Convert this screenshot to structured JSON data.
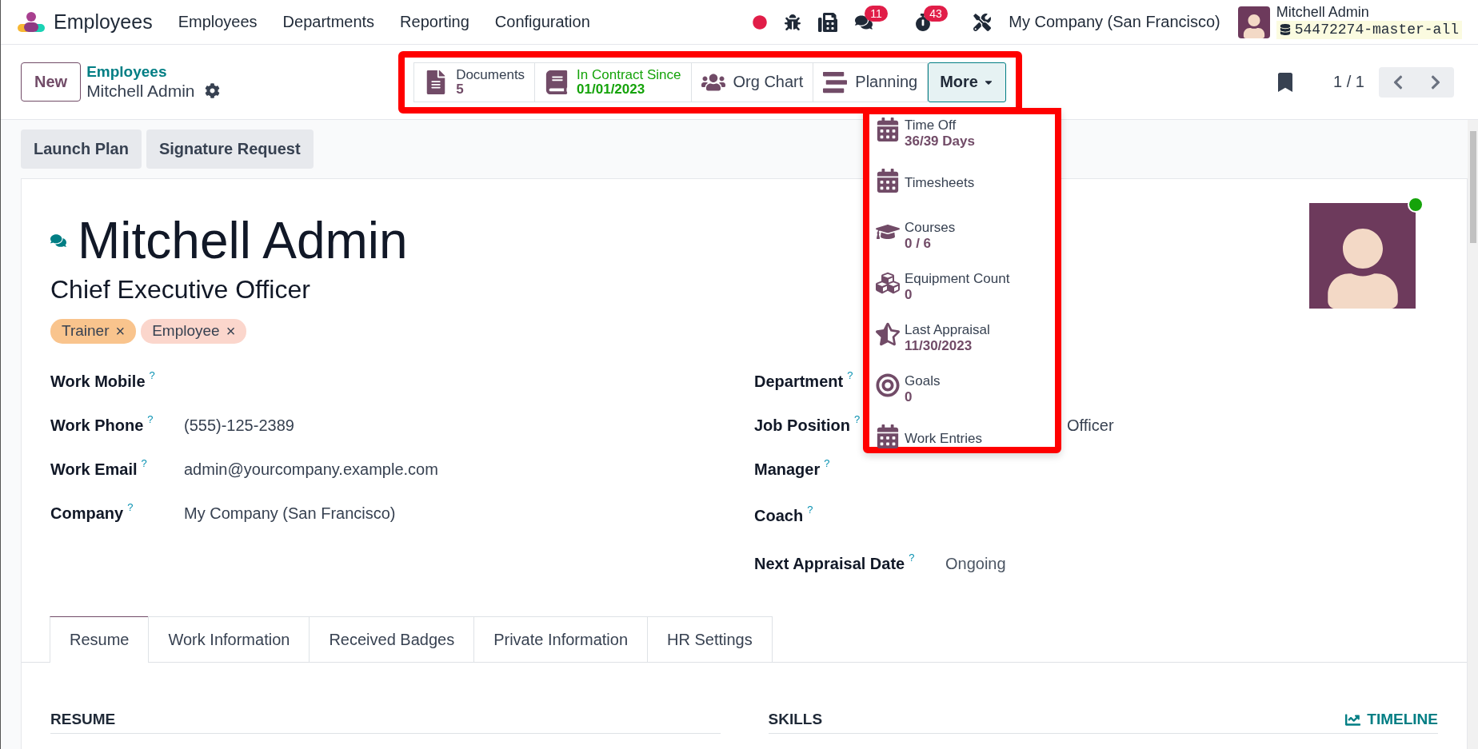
{
  "navbar": {
    "app_name": "Employees",
    "menu": [
      "Employees",
      "Departments",
      "Reporting",
      "Configuration"
    ],
    "messages_count": "11",
    "activities_count": "43",
    "company": "My Company (San Francisco)",
    "user_name": "Mitchell Admin",
    "database": "54472274-master-all"
  },
  "control_panel": {
    "new_button": "New",
    "breadcrumb": "Employees",
    "record": "Mitchell Admin",
    "pager": "1 / 1"
  },
  "smart_buttons": [
    {
      "kind": "documents",
      "label": "Documents",
      "value": "5",
      "highlight": false
    },
    {
      "kind": "contract",
      "label": "In Contract Since",
      "value": "01/01/2023",
      "highlight": true
    },
    {
      "kind": "org_chart",
      "label": "Org Chart",
      "highlight": false
    },
    {
      "kind": "planning",
      "label": "Planning",
      "highlight": false
    }
  ],
  "more_button": {
    "label": "More",
    "expanded": true
  },
  "more_menu": [
    {
      "kind": "calendar",
      "label": "Time Off",
      "value": "36/39 Days"
    },
    {
      "kind": "calendar",
      "label": "Timesheets"
    },
    {
      "kind": "course",
      "label": "Courses",
      "value": "0 / 6"
    },
    {
      "kind": "equipment",
      "label": "Equipment Count",
      "value": "0"
    },
    {
      "kind": "appraisal",
      "label": "Last Appraisal",
      "value": "11/30/2023"
    },
    {
      "kind": "goal",
      "label": "Goals",
      "value": "0"
    },
    {
      "kind": "calendar",
      "label": "Work Entries"
    }
  ],
  "actions": [
    "Launch Plan",
    "Signature Request"
  ],
  "employee": {
    "name": "Mitchell Admin",
    "job_title": "Chief Executive Officer",
    "online": true,
    "tags": [
      {
        "label": "Trainer",
        "remove": "×",
        "color": "#f9c48d"
      },
      {
        "label": "Employee",
        "remove": "×",
        "color": "#fbd6cc"
      }
    ]
  },
  "fields_left": [
    {
      "label": "Work Mobile",
      "help": "?"
    },
    {
      "label": "Work Phone",
      "help": "?",
      "value": "(555)-125-2389"
    },
    {
      "label": "Work Email",
      "help": "?",
      "value": "admin@yourcompany.example.com"
    },
    {
      "label": "Company",
      "help": "?",
      "value": "My Company (San Francisco)"
    }
  ],
  "fields_right": [
    {
      "label": "Department",
      "help": "?"
    },
    {
      "label": "Job Position",
      "help": "?",
      "value": "Officer",
      "partly_hidden": true
    },
    {
      "label": "Manager",
      "help": "?"
    },
    {
      "label": "Coach",
      "help": "?"
    },
    {
      "label": "Next Appraisal Date",
      "help": "?",
      "value": "Ongoing",
      "muted": true
    }
  ],
  "tabs": [
    {
      "label": "Resume",
      "selected": true
    },
    {
      "label": "Work Information",
      "selected": false
    },
    {
      "label": "Received Badges",
      "selected": false
    },
    {
      "label": "Private Information",
      "selected": false
    },
    {
      "label": "HR Settings",
      "selected": false
    }
  ],
  "resume": {
    "heading": "RESUME"
  },
  "skills": {
    "heading": "SKILLS",
    "timeline": "TIMELINE"
  }
}
